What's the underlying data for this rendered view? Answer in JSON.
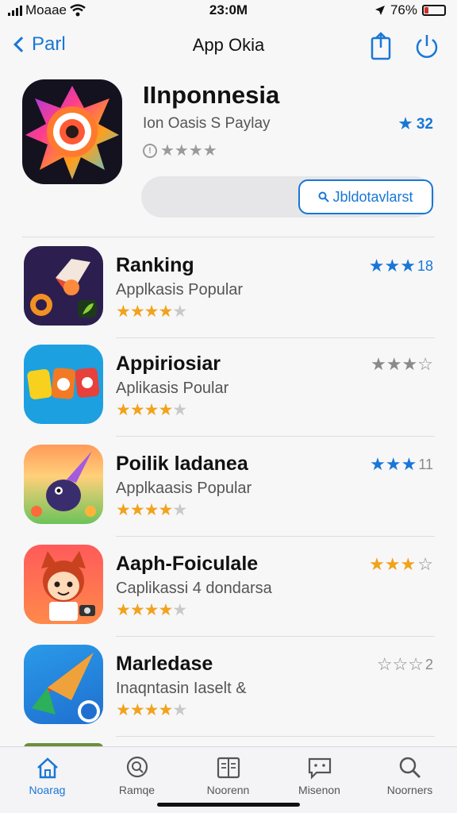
{
  "status": {
    "carrier": "Moaae",
    "time": "23:0M",
    "battery": "76%"
  },
  "nav": {
    "back_label": "Parl",
    "title": "App Okia"
  },
  "featured": {
    "title": "IInponnesia",
    "subtitle": "Ion Oasis S Paylay",
    "rating": "32",
    "button_label": "Jbldotavlarst"
  },
  "apps": [
    {
      "name": "Ranking",
      "subtitle": "Applkasis Popular",
      "stars": 4,
      "rating_stars": 3,
      "rating_color": "#1877d6",
      "rating": "18"
    },
    {
      "name": "Appiriosiar",
      "subtitle": "Aplikasis Poular",
      "stars": 4,
      "rating_stars": 3,
      "rating_color": "#8a8a8a",
      "rating": ""
    },
    {
      "name": "Poilik ladanea",
      "subtitle": "Applkaasis Popular",
      "stars": 4,
      "rating_stars": 3,
      "rating_color": "#1877d6",
      "rating": "11"
    },
    {
      "name": "Aaph-Foiculale",
      "subtitle": "Caplikassi 4 dondarsa",
      "stars": 4,
      "rating_stars": 3,
      "rating_color": "#f2a21b",
      "rating": ""
    },
    {
      "name": "Marledase",
      "subtitle": "Inaqntasin Iaselt  &",
      "stars": 4,
      "rating_stars": 0,
      "rating_color": "#8a8a8a",
      "rating": "2"
    }
  ],
  "tabs": [
    {
      "label": "Noarag",
      "icon": "home-icon",
      "active": true
    },
    {
      "label": "Ramqe",
      "icon": "search-circle-icon",
      "active": false
    },
    {
      "label": "Noorenn",
      "icon": "book-icon",
      "active": false
    },
    {
      "label": "Misenon",
      "icon": "chat-icon",
      "active": false
    },
    {
      "label": "Noorners",
      "icon": "search-icon",
      "active": false
    }
  ],
  "colors": {
    "accent": "#1877d6",
    "star": "#f2a21b"
  }
}
